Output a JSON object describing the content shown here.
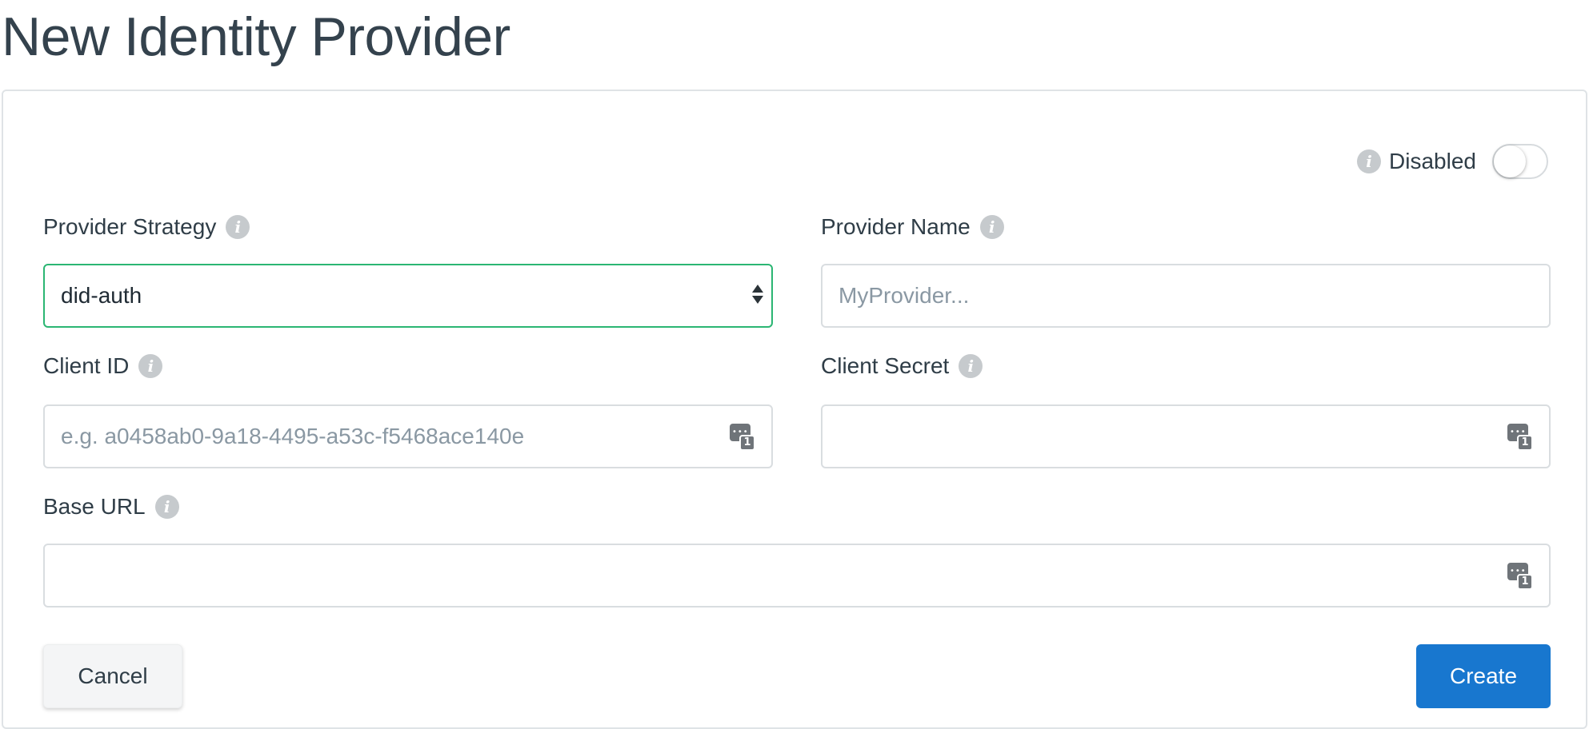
{
  "page": {
    "title": "New Identity Provider"
  },
  "toggle": {
    "label": "Disabled",
    "state": "off"
  },
  "fields": {
    "strategy": {
      "label": "Provider Strategy",
      "value": "did-auth"
    },
    "name": {
      "label": "Provider Name",
      "placeholder": "MyProvider..."
    },
    "client_id": {
      "label": "Client ID",
      "placeholder": "e.g. a0458ab0-9a18-4495-a53c-f5468ace140e"
    },
    "client_secret": {
      "label": "Client Secret",
      "value": ""
    },
    "base_url": {
      "label": "Base URL",
      "value": ""
    }
  },
  "password_badge": "1",
  "actions": {
    "cancel": "Cancel",
    "create": "Create"
  },
  "colors": {
    "accent": "#1877cf",
    "select_focus": "#2bb673",
    "info_icon": "#c6cacd"
  },
  "icons": {
    "info": "info-icon",
    "password_manager": "password-manager-icon",
    "select": "select-arrows-icon"
  }
}
